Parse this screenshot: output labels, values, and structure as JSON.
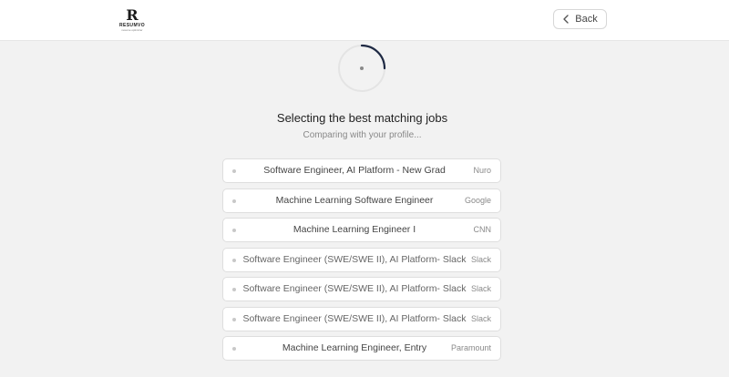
{
  "brand": {
    "mark": "R",
    "name": "RESUMVO",
    "tagline": "resume optimizer"
  },
  "header": {
    "back_label": "Back"
  },
  "status": {
    "title": "Selecting the best matching jobs",
    "subtitle": "Comparing with your profile..."
  },
  "jobs": [
    {
      "title": "Software Engineer, AI Platform - New Grad",
      "company": "Nuro"
    },
    {
      "title": "Machine Learning Software Engineer",
      "company": "Google"
    },
    {
      "title": "Machine Learning Engineer I",
      "company": "CNN"
    },
    {
      "title": "Software Engineer (SWE/SWE II), AI Platform- Slack",
      "company": "Slack"
    },
    {
      "title": "Software Engineer (SWE/SWE II), AI Platform- Slack",
      "company": "Slack"
    },
    {
      "title": "Software Engineer (SWE/SWE II), AI Platform- Slack",
      "company": "Slack"
    },
    {
      "title": "Machine Learning Engineer, Entry",
      "company": "Paramount"
    }
  ],
  "colors": {
    "spinner_accent": "#1f2a44",
    "spinner_track": "#e4e4e4"
  },
  "icons": {
    "back": "chevron-left-icon",
    "spinner": "loading-spinner-icon"
  }
}
